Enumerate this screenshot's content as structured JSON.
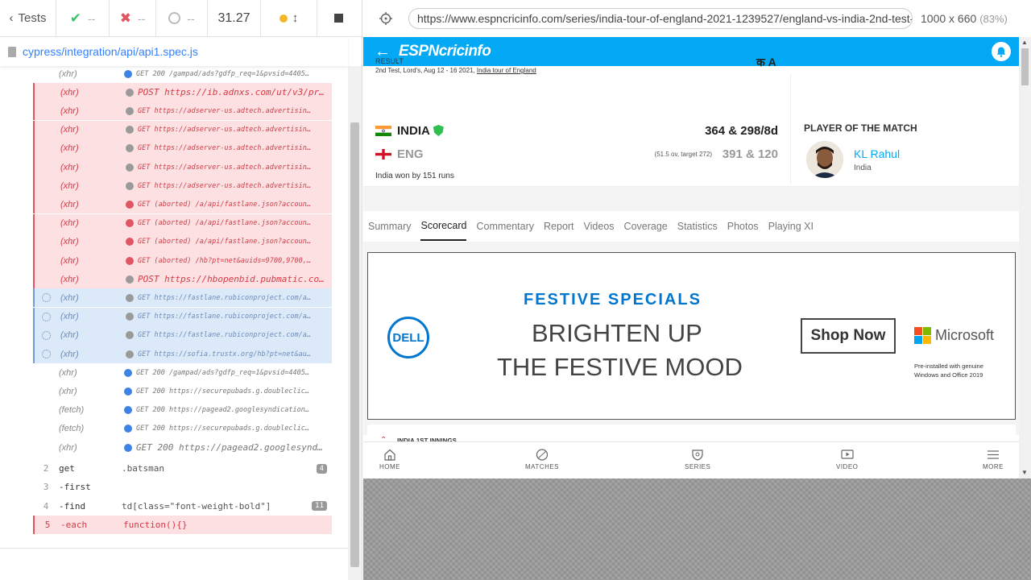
{
  "reporter": {
    "tests_label": "Tests",
    "passed": "--",
    "failed": "--",
    "pending": "--",
    "duration": "31.27",
    "spec_path": "cypress/integration/api/api1.spec.js",
    "commands": [
      {
        "label": "(xhr)",
        "msg": "GET 200 /gampad/ads?gdfp_req=1&pvsid=4405…",
        "state": "normal",
        "dot": "blue",
        "big": false
      },
      {
        "label": "(xhr)",
        "msg": "POST https://ib.adnxs.com/ut/v3/pr…",
        "state": "fail",
        "dot": "gray",
        "big": true
      },
      {
        "label": "(xhr)",
        "msg": "GET https://adserver-us.adtech.advertisin…",
        "state": "fail",
        "dot": "gray",
        "big": false
      },
      {
        "label": "(xhr)",
        "msg": "GET https://adserver-us.adtech.advertisin…",
        "state": "fail",
        "dot": "gray",
        "big": false
      },
      {
        "label": "(xhr)",
        "msg": "GET https://adserver-us.adtech.advertisin…",
        "state": "fail",
        "dot": "gray",
        "big": false
      },
      {
        "label": "(xhr)",
        "msg": "GET https://adserver-us.adtech.advertisin…",
        "state": "fail",
        "dot": "gray",
        "big": false
      },
      {
        "label": "(xhr)",
        "msg": "GET https://adserver-us.adtech.advertisin…",
        "state": "fail",
        "dot": "gray",
        "big": false
      },
      {
        "label": "(xhr)",
        "msg": "GET (aborted) /a/api/fastlane.json?accoun…",
        "state": "fail",
        "dot": "red",
        "big": false
      },
      {
        "label": "(xhr)",
        "msg": "GET (aborted) /a/api/fastlane.json?accoun…",
        "state": "fail",
        "dot": "red",
        "big": false
      },
      {
        "label": "(xhr)",
        "msg": "GET (aborted) /a/api/fastlane.json?accoun…",
        "state": "fail",
        "dot": "red",
        "big": false
      },
      {
        "label": "(xhr)",
        "msg": "GET (aborted) /hb?pt=net&auids=9700,9700,…",
        "state": "fail",
        "dot": "red",
        "big": false
      },
      {
        "label": "(xhr)",
        "msg": "POST https://hbopenbid.pubmatic.co…",
        "state": "fail",
        "dot": "gray",
        "big": true
      },
      {
        "label": "(xhr)",
        "msg": "GET https://fastlane.rubiconproject.com/a…",
        "state": "pending",
        "dot": "gray",
        "big": false
      },
      {
        "label": "(xhr)",
        "msg": "GET https://fastlane.rubiconproject.com/a…",
        "state": "pending",
        "dot": "gray",
        "big": false
      },
      {
        "label": "(xhr)",
        "msg": "GET https://fastlane.rubiconproject.com/a…",
        "state": "pending",
        "dot": "gray",
        "big": false
      },
      {
        "label": "(xhr)",
        "msg": "GET https://sofia.trustx.org/hb?pt=net&au…",
        "state": "pending",
        "dot": "gray",
        "big": false
      },
      {
        "label": "(xhr)",
        "msg": "GET 200 /gampad/ads?gdfp_req=1&pvsid=4405…",
        "state": "normal",
        "dot": "blue",
        "big": false
      },
      {
        "label": "(xhr)",
        "msg": "GET 200 https://securepubads.g.doubleclic…",
        "state": "normal",
        "dot": "blue",
        "big": false
      },
      {
        "label": "(fetch)",
        "msg": "GET 200 https://pagead2.googlesyndication…",
        "state": "normal",
        "dot": "blue",
        "big": false
      },
      {
        "label": "(fetch)",
        "msg": "GET 200 https://securepubads.g.doubleclic…",
        "state": "normal",
        "dot": "blue",
        "big": false
      },
      {
        "label": "(xhr)",
        "msg": "GET 200 https://pagead2.googlesynd…",
        "state": "normal",
        "dot": "blue",
        "big": true
      }
    ],
    "steps": [
      {
        "num": "2",
        "name": "get",
        "arg": ".batsman",
        "badge": "4",
        "state": "normal"
      },
      {
        "num": "3",
        "name": "-first",
        "arg": "",
        "badge": "",
        "state": "normal"
      },
      {
        "num": "4",
        "name": "-find",
        "arg": "td[class=\"font-weight-bold\"]",
        "badge": "11",
        "state": "normal"
      },
      {
        "num": "5",
        "name": "-each",
        "arg": "function(){}",
        "badge": "",
        "state": "fail"
      }
    ]
  },
  "aut": {
    "url": "https://www.espncricinfo.com/series/india-tour-of-england-2021-1239527/england-vs-india-2nd-test-1",
    "viewport": "1000 x 660",
    "zoom": "(83%)"
  },
  "espn": {
    "logo": "ESPNcricinfo",
    "result_label": "RESULT",
    "match_info_prefix": "2nd Test, Lord's, Aug 12 - 16 2021, ",
    "match_info_series": "India tour of England",
    "lang_icon": "क A",
    "teams": [
      {
        "name": "INDIA",
        "score": "364 & 298/8d",
        "overs": ""
      },
      {
        "name": "ENG",
        "score": "391 & 120",
        "overs": "(51.5 ov, target 272)"
      }
    ],
    "won_by": "India won by 151 runs",
    "potm_title": "PLAYER OF THE MATCH",
    "potm_name": "KL Rahul",
    "potm_country": "India",
    "tabs": [
      "Summary",
      "Scorecard",
      "Commentary",
      "Report",
      "Videos",
      "Coverage",
      "Statistics",
      "Photos",
      "Playing XI"
    ],
    "active_tab": "Scorecard",
    "ad": {
      "brand": "DELL",
      "kicker": "FESTIVE SPECIALS",
      "line1": "BRIGHTEN UP",
      "line2": "THE FESTIVE MOOD",
      "cta": "Shop Now",
      "partner": "Microsoft",
      "note": "Pre-installed with genuine Windows and Office 2019"
    },
    "innings_label": "INDIA 1ST INNINGS",
    "bottom_nav": [
      "HOME",
      "MATCHES",
      "SERIES",
      "VIDEO",
      "MORE"
    ]
  },
  "colors": {
    "espn_blue": "#03a9f4",
    "cypress_blue": "#3380ff",
    "fail_bg": "#fde0e2",
    "pending_bg": "#dce9f8",
    "dell_blue": "#0076ce"
  }
}
